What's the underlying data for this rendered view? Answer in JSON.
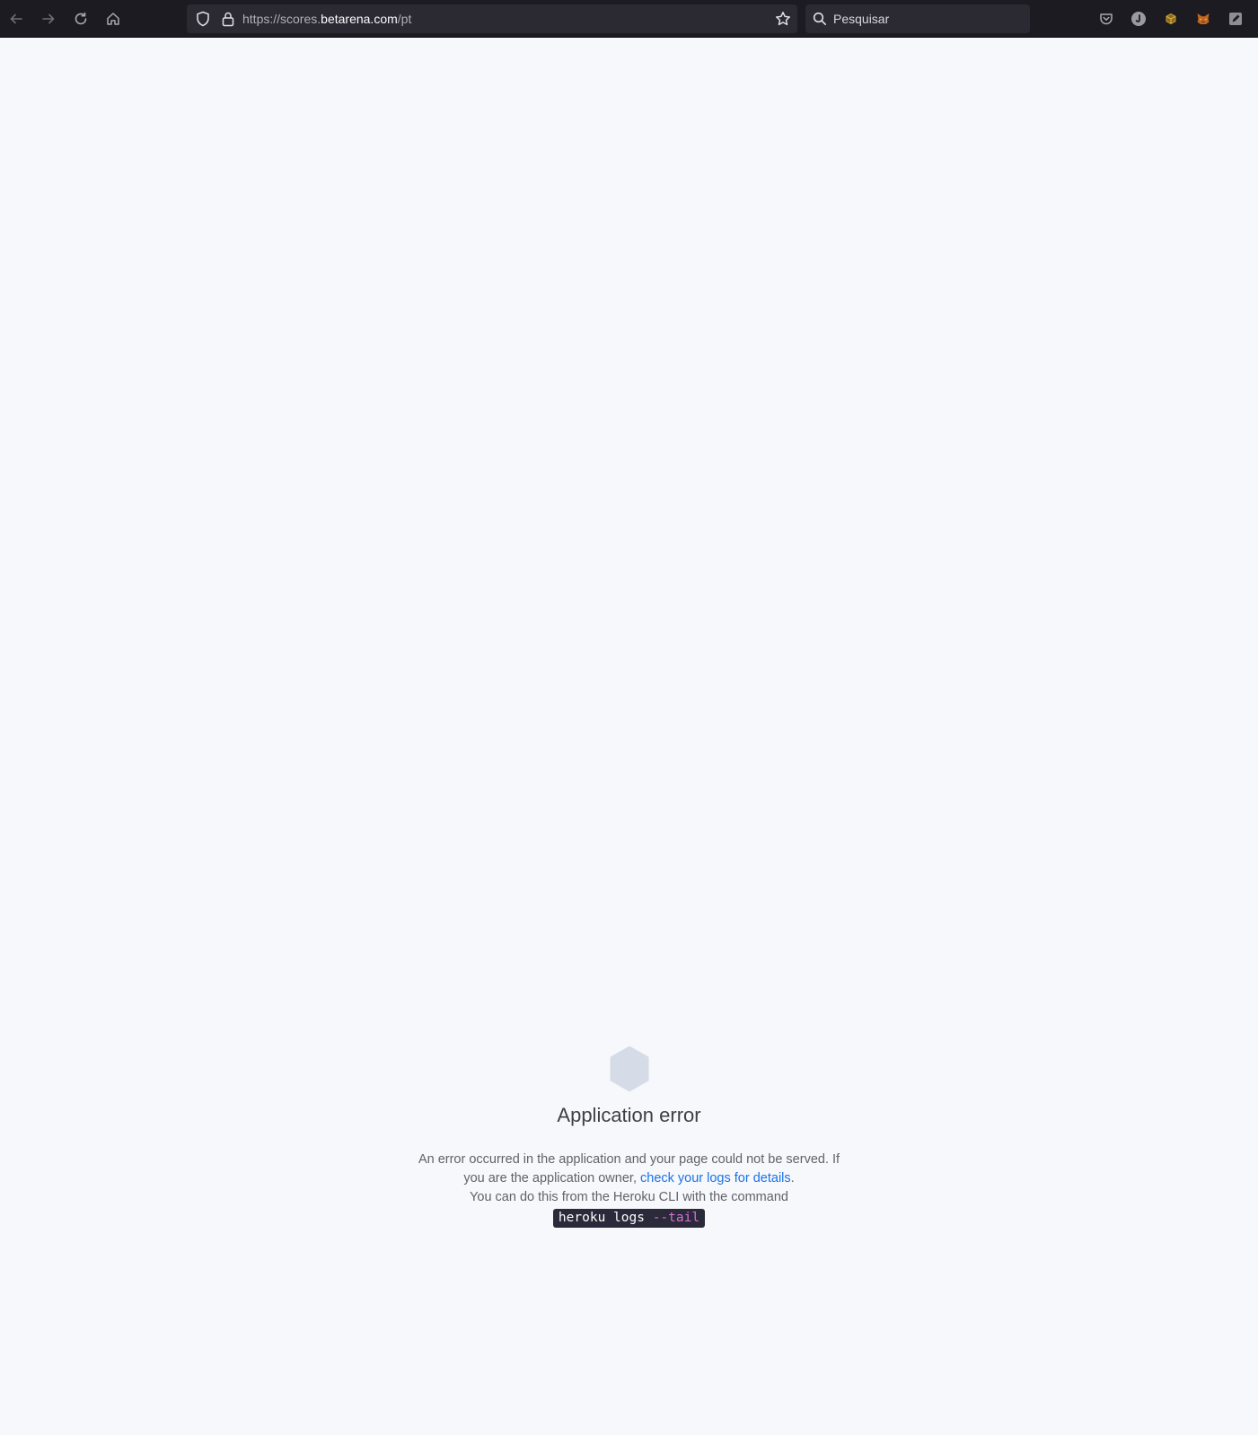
{
  "browser": {
    "url_prefix": "https://scores.",
    "url_domain": "betarena.com",
    "url_path": "/pt",
    "search_placeholder": "Pesquisar",
    "icons": [
      "back-arrow-icon",
      "forward-arrow-icon",
      "reload-icon",
      "home-icon",
      "shield-icon",
      "lock-icon",
      "bookmark-star-icon",
      "search-icon",
      "pocket-icon",
      "extension-j-icon",
      "extension-cube-icon",
      "metamask-fox-icon",
      "extension-edit-icon"
    ]
  },
  "error": {
    "title": "Application error",
    "line1": "An error occurred in the application and your page could not be served. If you are the application owner, ",
    "link_text": "check your logs for details",
    "line1_end": ".",
    "line2": "You can do this from the Heroku CLI with the command",
    "command_base": "heroku logs ",
    "command_flag": "--tail"
  },
  "colors": {
    "page_background": "#f6f8fb",
    "toolbar_background": "#1c1b22",
    "link": "#1a73e8",
    "hex_icon": "#d5dce7"
  }
}
